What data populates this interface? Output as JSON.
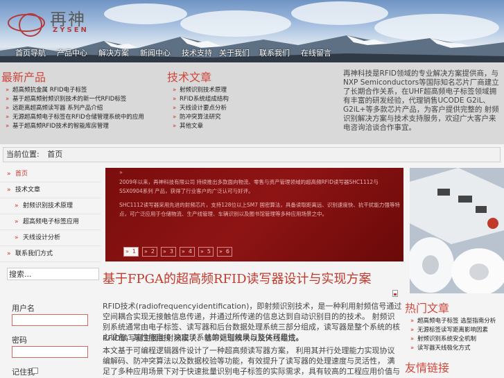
{
  "header": {
    "logo_zh": "再神",
    "logo_en": "ZYSEN",
    "nav": [
      "首页导航",
      "产品中心",
      "解决方案",
      "新闻中心",
      "技术支持",
      "关于我们",
      "联系我们",
      "在线留言"
    ]
  },
  "top": {
    "col1_title": "最新产品",
    "col1_items": [
      "超高频抗金属 RFID电子标签",
      "基于超高频射频识别技术的新一代RFID标签",
      "远距离超高频读写器 系列产品介绍",
      "无源超高频电子标签在RFID仓储管理系统中的应用",
      "基于超高频RFID技术的智能库房管理"
    ],
    "col2_title": "技术文章",
    "col2_items": [
      "射频识别技术原理",
      "RFID系统组成结构",
      "天线设计要点分析",
      "防冲突算法研究",
      "其他文章"
    ],
    "right_text": "再神科技是RFID领域的专业解决方案提供商，与NXP Semiconductors等国际知名芯片厂商建立了长期合作关系，在UHF超高频电子标签领域拥有丰富的研发经验，代理销售UCODE G2iL、G2iL+等多款芯片产品，为客户提供完整的 射频识别解决方案与技术支持服务，欢迎广大客户来电咨询洽谈合作事宜。"
  },
  "breadcrumb": {
    "label": "当前位置:",
    "current": "首页"
  },
  "sidebar": {
    "items": [
      {
        "label": "首页",
        "sub": false,
        "active": true
      },
      {
        "label": "技术文章",
        "sub": false,
        "active": false
      },
      {
        "label": "射频识别技术原理",
        "sub": true,
        "active": false
      },
      {
        "label": "超高频电子标签应用",
        "sub": true,
        "active": false
      },
      {
        "label": "天线设计分析",
        "sub": true,
        "active": false
      },
      {
        "label": "联系我们方式",
        "sub": false,
        "active": false
      }
    ],
    "search_value": "搜索...",
    "login_user_label": "用户名",
    "login_pass_label": "密码",
    "remember_label": "记住我"
  },
  "slider": {
    "para1": "2009年以来，再神科技有限公司 持续推出多款面向物流、零售与资产管理领域的超高频RFID读写器SHC1112与SSX0904系列 产品，获得了行业客户的广泛认可与好评。",
    "para2": "SHC1112读写器采用先进的射频芯片，支持128位以上SM7 国密算法，具备读取距离远、识别速度快、抗干扰能力强等特点，可广泛应用于仓储物流、生产线管理、车辆识别以及图书馆管理等多种应用场景之中。",
    "pages": [
      "1",
      "2",
      "3",
      "4",
      "5",
      "6"
    ]
  },
  "article": {
    "title": "基于FPGA的超高频RFID读写器设计与实现方案",
    "p1": "RFID技术(radiofrequencyidentification)，即射频识别技术，是一种利用射频信号通过空间耦合实现无接触信息传递，并通过所传递的信息达到自动识别目的的技术。 射频识别系统通常由电子标签、读写器和后台数据处理系统三部分组成，读写器是整个系统的核心设备，其性能直接 决定了系统的识别效果与整体可靠性。",
    "p2": "RFID读写器主要由射频模块、基带处理模块以及天线组成。",
    "p3": "本文基于可编程逻辑器件设计了一种超高频读写器方案， 利用其并行处理能力实现协议编解码、防冲突算法以及数据校验等功能，有效提升了读写器的处理速度与灵活性， 满足了多种应用场景下对于快速批量识别电子标签的实际需求，具有较高的工程应用价值与推广意义。"
  },
  "right_col": {
    "title1": "热门文章",
    "items": [
      "超高频电子标签 选型指南分析",
      "无源标签读写距离影响因素",
      "射频识别系统安全机制",
      "读写器天线极化方式"
    ],
    "title2": "友情链接"
  }
}
